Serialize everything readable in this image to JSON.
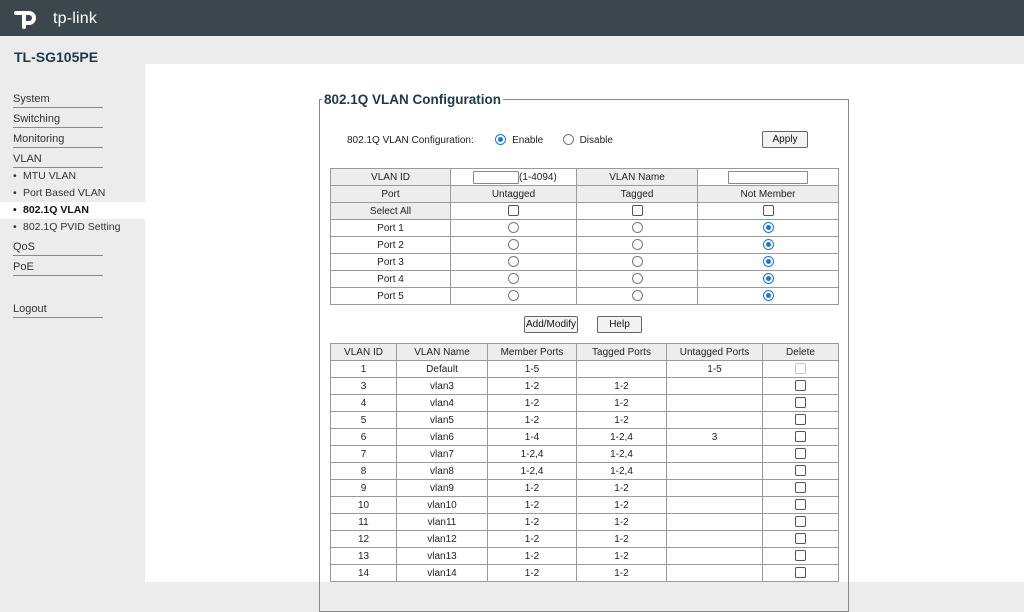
{
  "brand": {
    "logo_text": "tp-link",
    "model": "TL-SG105PE"
  },
  "sidebar": {
    "items": [
      {
        "label": "System",
        "type": "main"
      },
      {
        "label": "Switching",
        "type": "main"
      },
      {
        "label": "Monitoring",
        "type": "main"
      },
      {
        "label": "VLAN",
        "type": "main"
      },
      {
        "label": "MTU VLAN",
        "type": "sub"
      },
      {
        "label": "Port Based VLAN",
        "type": "sub"
      },
      {
        "label": "802.1Q VLAN",
        "type": "sub",
        "active": true
      },
      {
        "label": "802.1Q PVID Setting",
        "type": "sub"
      },
      {
        "label": "QoS",
        "type": "main"
      },
      {
        "label": "PoE",
        "type": "main"
      }
    ],
    "logout": "Logout",
    "bullet": "•"
  },
  "panel": {
    "title": "802.1Q VLAN Configuration",
    "config_label": "802.1Q VLAN Configuration:",
    "enable_label": "Enable",
    "disable_label": "Disable",
    "enabled": true,
    "apply_label": "Apply"
  },
  "form": {
    "vlan_id_label": "VLAN ID",
    "vlan_id_value": "",
    "vlan_id_range": "(1-4094)",
    "vlan_name_label": "VLAN Name",
    "vlan_name_value": "",
    "port_header": "Port",
    "untagged_header": "Untagged",
    "tagged_header": "Tagged",
    "not_member_header": "Not Member",
    "select_all_label": "Select All",
    "ports": [
      {
        "label": "Port 1",
        "selected": "not_member"
      },
      {
        "label": "Port 2",
        "selected": "not_member"
      },
      {
        "label": "Port 3",
        "selected": "not_member"
      },
      {
        "label": "Port 4",
        "selected": "not_member"
      },
      {
        "label": "Port 5",
        "selected": "not_member"
      }
    ],
    "add_modify_label": "Add/Modify",
    "help_label": "Help"
  },
  "vlan_table": {
    "headers": [
      "VLAN ID",
      "VLAN Name",
      "Member Ports",
      "Tagged Ports",
      "Untagged Ports",
      "Delete"
    ],
    "rows": [
      {
        "id": "1",
        "name": "Default",
        "member": "1-5",
        "tagged": "",
        "untagged": "1-5",
        "deletable": false
      },
      {
        "id": "3",
        "name": "vlan3",
        "member": "1-2",
        "tagged": "1-2",
        "untagged": "",
        "deletable": true
      },
      {
        "id": "4",
        "name": "vlan4",
        "member": "1-2",
        "tagged": "1-2",
        "untagged": "",
        "deletable": true
      },
      {
        "id": "5",
        "name": "vlan5",
        "member": "1-2",
        "tagged": "1-2",
        "untagged": "",
        "deletable": true
      },
      {
        "id": "6",
        "name": "vlan6",
        "member": "1-4",
        "tagged": "1-2,4",
        "untagged": "3",
        "deletable": true
      },
      {
        "id": "7",
        "name": "vlan7",
        "member": "1-2,4",
        "tagged": "1-2,4",
        "untagged": "",
        "deletable": true
      },
      {
        "id": "8",
        "name": "vlan8",
        "member": "1-2,4",
        "tagged": "1-2,4",
        "untagged": "",
        "deletable": true
      },
      {
        "id": "9",
        "name": "vlan9",
        "member": "1-2",
        "tagged": "1-2",
        "untagged": "",
        "deletable": true
      },
      {
        "id": "10",
        "name": "vlan10",
        "member": "1-2",
        "tagged": "1-2",
        "untagged": "",
        "deletable": true
      },
      {
        "id": "11",
        "name": "vlan11",
        "member": "1-2",
        "tagged": "1-2",
        "untagged": "",
        "deletable": true
      },
      {
        "id": "12",
        "name": "vlan12",
        "member": "1-2",
        "tagged": "1-2",
        "untagged": "",
        "deletable": true
      },
      {
        "id": "13",
        "name": "vlan13",
        "member": "1-2",
        "tagged": "1-2",
        "untagged": "",
        "deletable": true
      },
      {
        "id": "14",
        "name": "vlan14",
        "member": "1-2",
        "tagged": "1-2",
        "untagged": "",
        "deletable": true
      }
    ]
  },
  "colors": {
    "topbar": "#3c474d",
    "accent_radio": "#1a73e8",
    "title": "#1c3a4a"
  }
}
